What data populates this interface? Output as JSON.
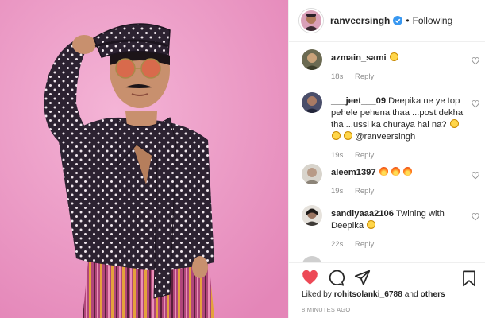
{
  "post": {
    "photo_alt": "",
    "header": {
      "username": "ranveersingh",
      "separator": "•",
      "follow_label": "Following"
    },
    "comments": [
      {
        "username": "azmain_sami",
        "text": "",
        "emojis": [
          "laugh"
        ],
        "age": "18s",
        "reply_label": "Reply"
      },
      {
        "username": "___jeet___09",
        "text": "Deepika ne ye top pehele pehena thaa ...post dekha tha ...ussi ka churaya hai na?",
        "trailing": "@ranveersingh",
        "emojis": [
          "laugh",
          "laugh",
          "laugh"
        ],
        "age": "19s",
        "reply_label": "Reply"
      },
      {
        "username": "aleem1397",
        "text": "",
        "emojis": [
          "fire",
          "fire",
          "fire"
        ],
        "age": "19s",
        "reply_label": "Reply"
      },
      {
        "username": "sandiyaaa2106",
        "text": "Twining with Deepika",
        "emojis": [
          "laugh"
        ],
        "age": "22s",
        "reply_label": "Reply"
      }
    ],
    "likes": {
      "prefix": "Liked by",
      "user": "rohitsolanki_6788",
      "conjunction": "and",
      "others": "others"
    },
    "timestamp": "8 MINUTES AGO"
  },
  "colors": {
    "background_pink": "#ec9cc7",
    "like_red": "#ed4956",
    "verified_blue": "#3897f0",
    "muted": "#8e8e8e"
  },
  "icons": {
    "like": "heart-icon",
    "comment": "comment-icon",
    "share": "paper-plane-icon",
    "save": "bookmark-icon",
    "verified": "verified-badge-icon"
  }
}
